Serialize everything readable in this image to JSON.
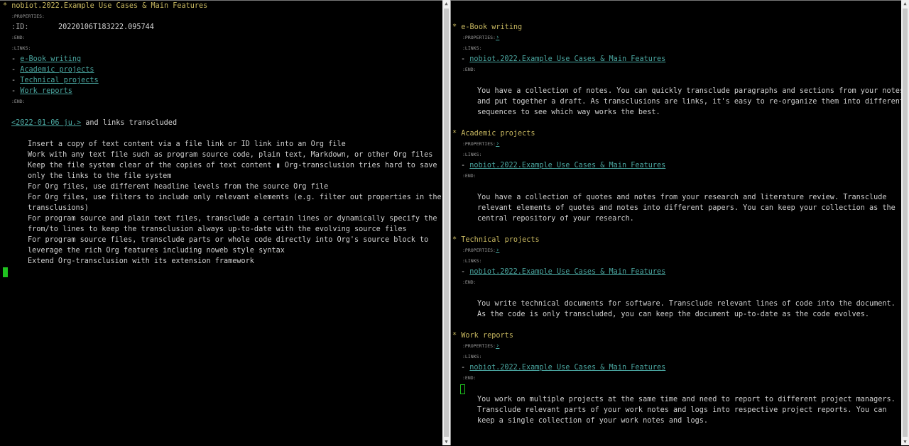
{
  "left": {
    "title": "nobiot.2022.Example Use Cases & Main Features",
    "properties_drawer": ":PROPERTIES:",
    "id_key": ":ID:",
    "id_value": "20220106T183222.095744",
    "end1": ":END:",
    "links_drawer": ":LINKS:",
    "links": [
      "e-Book writing",
      "Academic projects",
      "Technical projects",
      "Work reports"
    ],
    "dash": "-",
    "end2": ":END:",
    "timestamp": "<2022-01-06 ju.>",
    "timestamp_suffix": " and links transcluded",
    "features": [
      "Insert a copy of text content via a file link or ID link into an Org file",
      "Work with any text file such as program source code, plain text, Markdown, or other Org files",
      "Keep the file system clear of the copies of text content ▮ Org-transclusion tries hard to save",
      "only the links to the file system",
      "For Org files, use different headline levels from the source Org file",
      "For Org files, use filters to include only relevant elements (e.g. filter out properties in the",
      "transclusions)",
      "For program source and plain text files, transclude a certain lines or dynamically specify the",
      "from/to lines to keep the transclusion always up-to-date with the evolving source files",
      "For program source files, transclude parts or whole code directly into Org's source block to",
      "leverage the rich Org features including noweb style syntax",
      "Extend Org-transclusion with its extension framework"
    ]
  },
  "right": {
    "star": "*",
    "properties_label": ":PROPERTIES:",
    "properties_fold": "›",
    "links_label": ":LINKS:",
    "end_label": ":END:",
    "dash": "-",
    "backlink": "nobiot.2022.Example Use Cases & Main Features",
    "sections": [
      {
        "heading": "e-Book writing",
        "body": [
          "You have a collection of notes. You can quickly transclude paragraphs and sections from your notes",
          "and put together a draft. As transclusions are links, it's easy to re-organize them into different",
          "sequences to see which way works the best."
        ]
      },
      {
        "heading": "Academic projects",
        "body": [
          "You have a collection of quotes and notes from your research and literature review. Transclude",
          "relevant elements of quotes and notes into different papers. You can keep your collection as the",
          "central repository of your research."
        ]
      },
      {
        "heading": "Technical projects",
        "body": [
          "You write technical documents for software. Transclude relevant lines of code into the document.",
          "As the code is only transcluded, you can keep the document up-to-date as the code evolves."
        ]
      },
      {
        "heading": "Work reports",
        "body": [
          "You work on multiple projects at the same time and need to report to different project managers.",
          "Transclude relevant parts of your work notes and logs into respective project reports. You can",
          "keep a single collection of your work notes and logs."
        ]
      }
    ]
  },
  "colors": {
    "background": "#000000",
    "heading": "#c8b860",
    "link": "#4aa6a0",
    "cursor": "#1fc21f"
  }
}
